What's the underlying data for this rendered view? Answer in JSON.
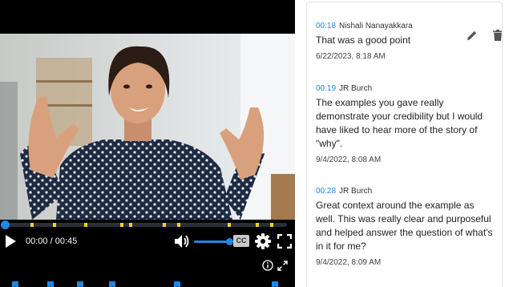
{
  "player": {
    "current_time": "00:00",
    "duration": "00:45",
    "progress_fraction": 0.0,
    "volume_fraction": 1.0,
    "cc_label": "CC",
    "comment_markers_fraction": [
      0.09,
      0.17,
      0.28,
      0.41,
      0.44,
      0.56,
      0.61,
      0.79,
      0.89,
      0.94
    ],
    "bookmark_fractions": [
      0.04,
      0.16,
      0.26,
      0.37,
      0.59,
      0.92
    ],
    "accent_color": "#1e88e5",
    "marker_color": "#f4d21b"
  },
  "comments": [
    {
      "time": "00:18",
      "author": "Nishali Nanayakkara",
      "text": "That was a good point",
      "date": "6/22/2023, 8:18 AM",
      "has_actions": true
    },
    {
      "time": "00:19",
      "author": "JR Burch",
      "text": "The examples you gave really demonstrate your credibility but I would have liked to hear more of the story of \"why\".",
      "date": "9/4/2022, 8:08 AM"
    },
    {
      "time": "00:28",
      "author": "JR Burch",
      "text": "Great context around the example as well. This was really clear and purposeful and helped answer the question of what's in it for me?",
      "date": "9/4/2022, 8:09 AM"
    }
  ],
  "icons": {
    "play": "play-icon",
    "volume": "volume-icon",
    "settings": "gear-icon",
    "fullscreen": "fullscreen-icon",
    "info": "info-icon",
    "expand": "expand-icon",
    "edit": "pencil-icon",
    "delete": "trash-icon",
    "bookmark": "bookmark-icon"
  }
}
